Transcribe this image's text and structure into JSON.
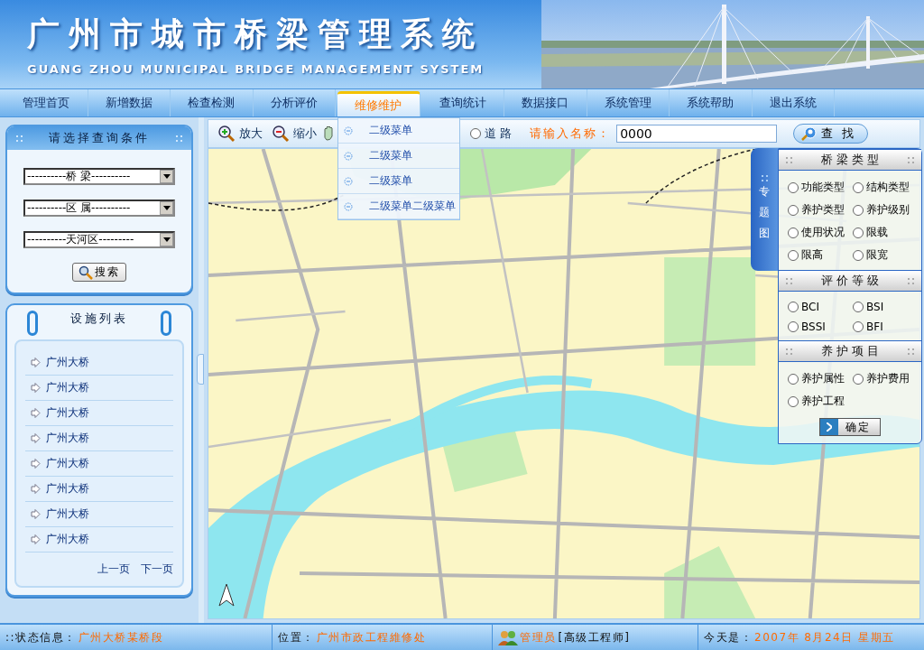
{
  "header": {
    "title": "广州市城市桥梁管理系统",
    "subtitle": "GUANG ZHOU MUNICIPAL BRIDGE MANAGEMENT SYSTEM"
  },
  "nav": [
    {
      "label": "管理首页",
      "selected": false
    },
    {
      "label": "新增数据",
      "selected": false
    },
    {
      "label": "检查检测",
      "selected": false
    },
    {
      "label": "分析评价",
      "selected": false
    },
    {
      "label": "维修维护",
      "selected": true
    },
    {
      "label": "查询统计",
      "selected": false
    },
    {
      "label": "数据接口",
      "selected": false
    },
    {
      "label": "系统管理",
      "selected": false
    },
    {
      "label": "系统帮助",
      "selected": false
    },
    {
      "label": "退出系统",
      "selected": false
    }
  ],
  "dropdown": [
    "二级菜单",
    "二级菜单",
    "二级菜单",
    "二级菜单二级菜单"
  ],
  "query_panel": {
    "title": "请选择查询条件",
    "selects": [
      "----------桥 梁----------",
      "----------区 属----------",
      "----------天河区---------"
    ],
    "button": "搜索"
  },
  "facility_panel": {
    "title": "设施列表",
    "items": [
      "广州大桥",
      "广州大桥",
      "广州大桥",
      "广州大桥",
      "广州大桥",
      "广州大桥",
      "广州大桥",
      "广州大桥"
    ],
    "prev": "上一页",
    "next": "下一页"
  },
  "toolbar": {
    "zoom_in": "放大",
    "zoom_out": "缩小",
    "road": {
      "label": "道 路",
      "selected": false
    },
    "name_label": "请输入名称：",
    "name_value": "0000",
    "find": "查 找"
  },
  "side_tab": "专题图",
  "thematic": [
    {
      "title": "桥 梁 类 型",
      "options": [
        {
          "label": "功能类型",
          "selected": false
        },
        {
          "label": "结构类型",
          "selected": false
        },
        {
          "label": "养护类型",
          "selected": false
        },
        {
          "label": "养护级别",
          "selected": false
        },
        {
          "label": "使用状况",
          "selected": false
        },
        {
          "label": "限载",
          "selected": false
        },
        {
          "label": "限高",
          "selected": false
        },
        {
          "label": "限宽",
          "selected": false
        }
      ]
    },
    {
      "title": "评 价 等 级",
      "options": [
        {
          "label": "BCI",
          "selected": false
        },
        {
          "label": "BSI",
          "selected": false
        },
        {
          "label": "BSSI",
          "selected": false
        },
        {
          "label": "BFI",
          "selected": false
        }
      ]
    },
    {
      "title": "养 护 项 目",
      "options": [
        {
          "label": "养护属性",
          "selected": false
        },
        {
          "label": "养护费用",
          "selected": false
        },
        {
          "label": "养护工程",
          "selected": false
        }
      ]
    }
  ],
  "confirm": "确定",
  "status": {
    "state_label": "::状态信息：",
    "state_value": "广州大桥某桥段",
    "location_label": "位置：",
    "location_value": "广州市政工程維修处",
    "role": "管理员",
    "title": "[高级工程师]",
    "date_label": "今天是：",
    "date_value": "2007年 8月24日 星期五"
  }
}
